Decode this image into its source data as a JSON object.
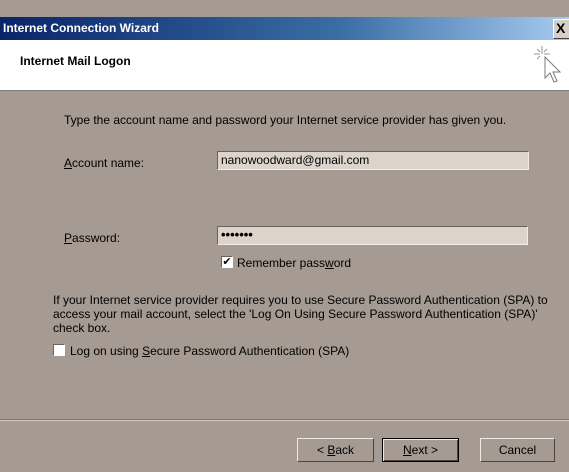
{
  "window": {
    "title": "Internet Connection Wizard",
    "close_glyph": "X"
  },
  "header": {
    "title": "Internet Mail Logon",
    "icon": "wizard-cursor-icon"
  },
  "intro": "Type the account name and password your Internet service provider has given you.",
  "account": {
    "label_u": "A",
    "label_rest": "ccount name:",
    "value": "nanowoodward@gmail.com"
  },
  "password": {
    "label_u": "P",
    "label_rest": "assword:",
    "value": "•••••••"
  },
  "remember": {
    "checked_glyph": "✔",
    "label_pre": "Remember pass",
    "label_u": "w",
    "label_post": "ord"
  },
  "spa_note": [
    "If your Internet service provider requires you to use Secure Password Authentication (SPA) to",
    "access your mail account, select the 'Log On Using Secure Password Authentication (SPA)'",
    "check box."
  ],
  "spa_checkbox": {
    "label_pre": "Log on using ",
    "label_u": "S",
    "label_post": "ecure Password Authentication (SPA)"
  },
  "buttons": {
    "back_pre": "< ",
    "back_u": "B",
    "back_post": "ack",
    "next_u": "N",
    "next_post": "ext >",
    "cancel": "Cancel"
  }
}
